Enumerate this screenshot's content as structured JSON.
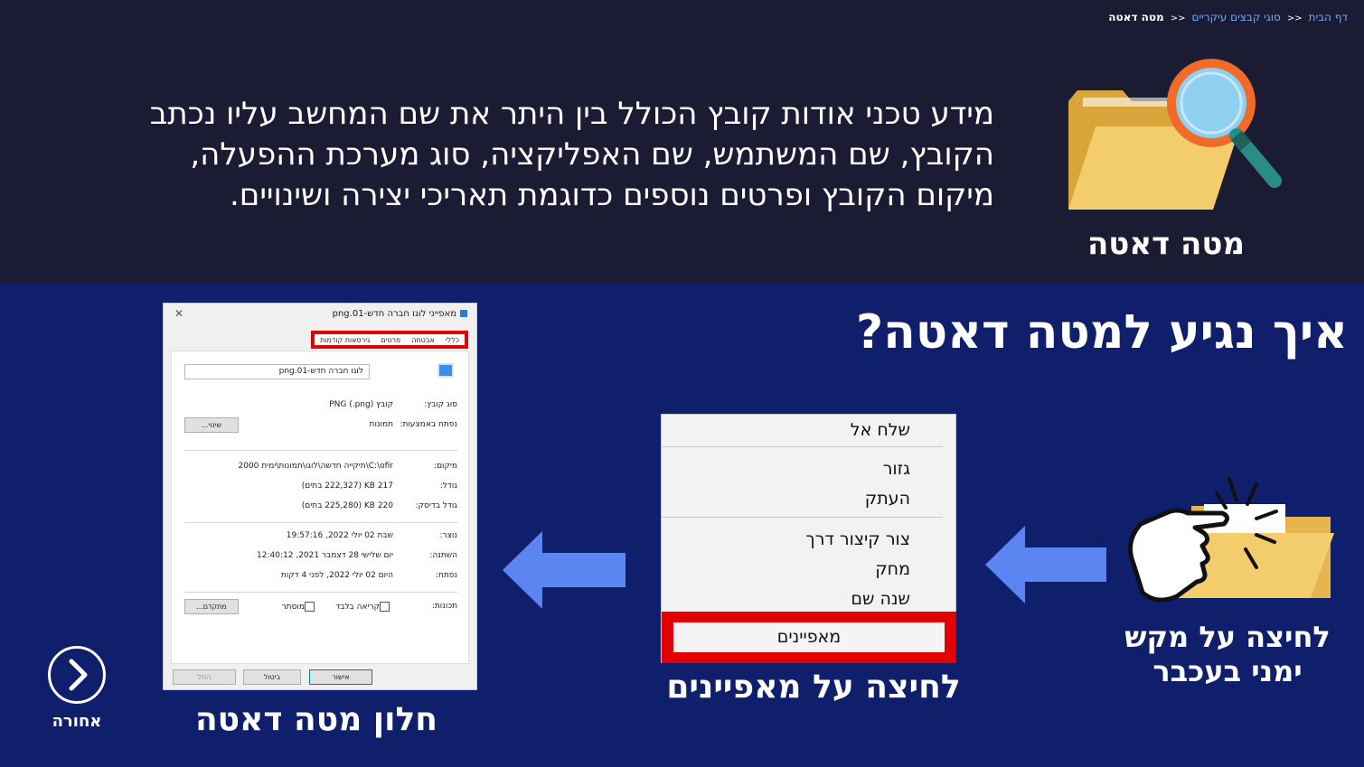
{
  "breadcrumb": {
    "home": "דף הבית",
    "section": "סוגי קבצים עיקריים",
    "current": "מטה דאטה",
    "separator": "<<"
  },
  "hero": {
    "title": "מטה דאטה",
    "description": "מידע טכני אודות קובץ הכולל בין היתר את שם המחשב עליו נכתב הקובץ, שם המשתמש, שם האפליקציה, סוג מערכת ההפעלה, מיקום הקובץ ופרטים נוספים כדוגמת תאריכי יצירה ושינויים.",
    "icon": "folder-magnifier-icon"
  },
  "question": "איך נגיע למטה דאטה?",
  "steps": {
    "right_click_label": "לחיצה על מקש ימני בעכבר",
    "properties_click_label": "לחיצה על מאפיינים",
    "metadata_window_label": "חלון מטה דאטה"
  },
  "context_menu": {
    "items": [
      "שלח אל",
      "גזור",
      "העתק",
      "צור קיצור דרך",
      "מחק",
      "שנה שם",
      "מאפיינים"
    ]
  },
  "properties_window": {
    "title": "מאפייני לוגו חברה חדש-01.png",
    "close": "✕",
    "tabs": [
      "כללי",
      "אבטחה",
      "פרטים",
      "גירסאות קודמות"
    ],
    "filename": "לוגו חברה חדש-01.png",
    "rows": [
      {
        "label": "סוג קובץ:",
        "value": "קובץ PNG (.png)"
      },
      {
        "label": "נפתח באמצעות:",
        "value": "תמונות"
      },
      {
        "label": "מיקום:",
        "value": "C:\\ofir\\תיקייה חדשה\\לוגו\\תמונות\\ימית 2000"
      },
      {
        "label": "גודל:",
        "value": "217 KB (222,327 בתים)"
      },
      {
        "label": "גודל בדיסק:",
        "value": "220 KB (225,280 בתים)"
      },
      {
        "label": "נוצר:",
        "value": "שבת 02 יולי 2022, 19:57:16"
      },
      {
        "label": "השתנה:",
        "value": "יום שלישי 28 דצמבר 2021, 12:40:12"
      },
      {
        "label": "נפתח:",
        "value": "היום 02 יולי 2022, לפני 4 דקות"
      }
    ],
    "attributes_label": "תכונות:",
    "readonly_label": "קריאה בלבד",
    "hidden_label": "מוסתר",
    "change_button": "שינוי...",
    "advanced_button": "מתקדם...",
    "ok_button": "אישור",
    "cancel_button": "ביטול",
    "apply_button": "החל"
  },
  "nav": {
    "back_label": "אחורה"
  },
  "colors": {
    "top_bg": "#1b1c33",
    "bottom_bg": "#0f1f6b",
    "arrow": "#5b86f2",
    "highlight": "#e20000",
    "folder": "#f3cd6c"
  }
}
